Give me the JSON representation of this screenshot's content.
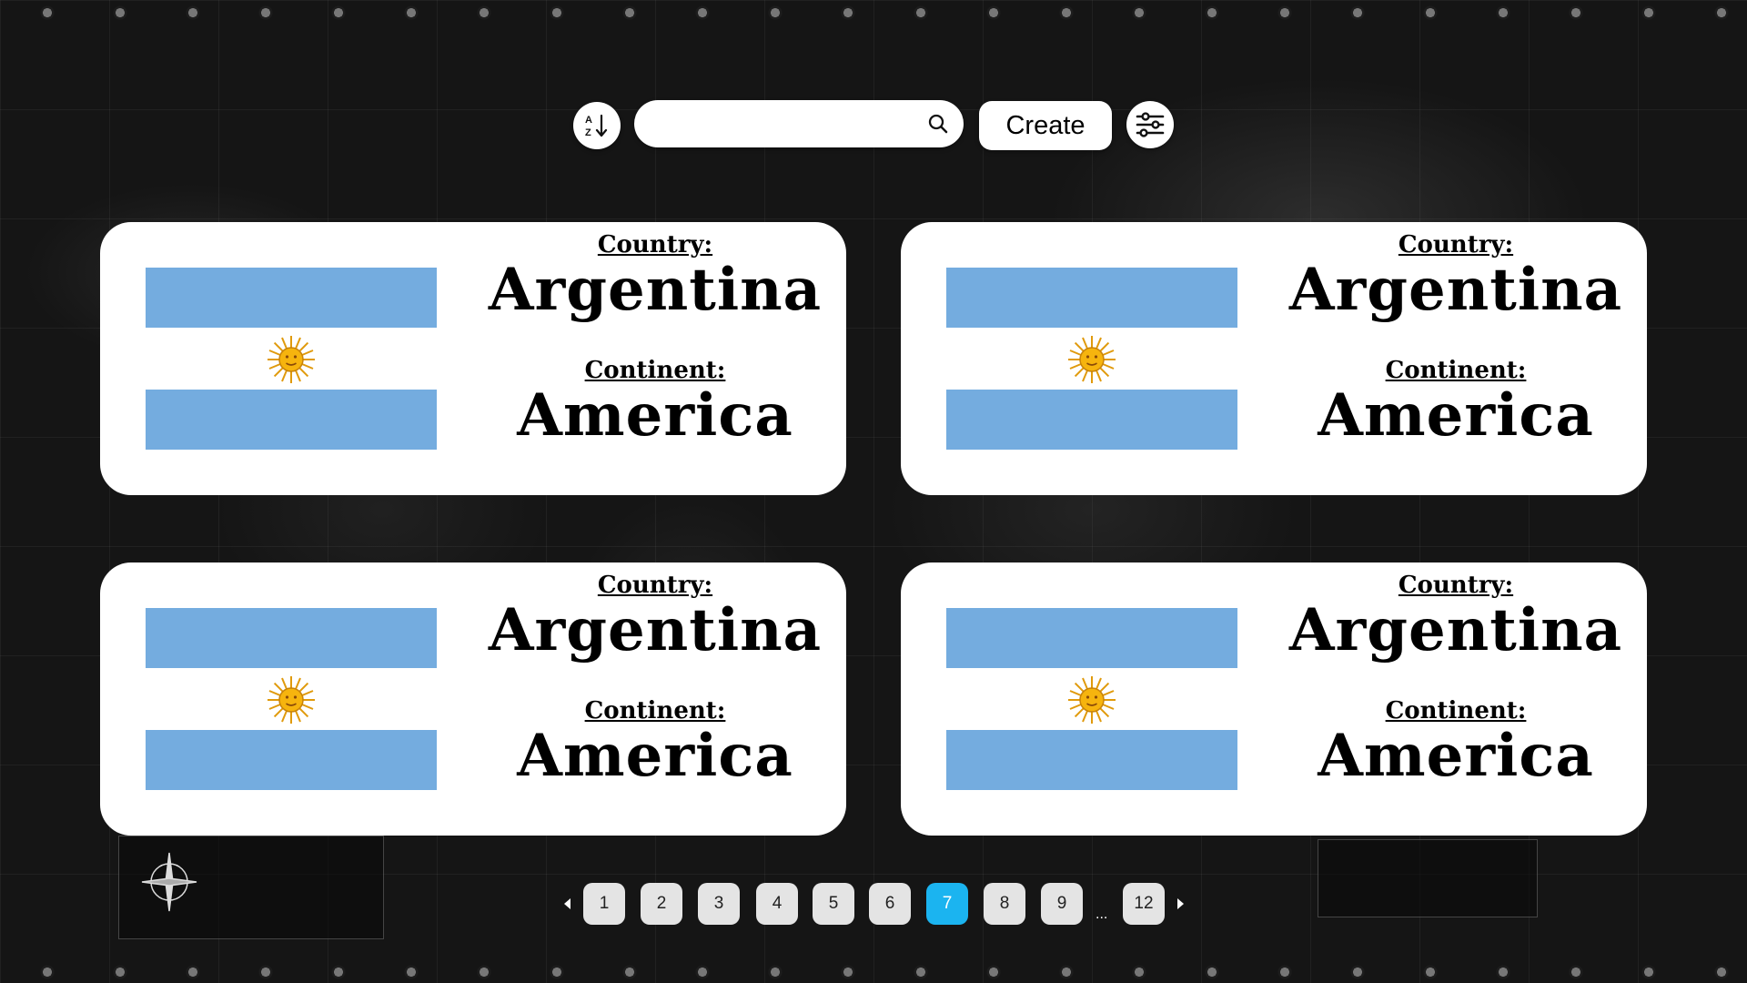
{
  "toolbar": {
    "sort_icon": "sort-alpha-icon",
    "search_value": "",
    "search_icon": "search-icon",
    "create_label": "Create",
    "filter_icon": "sliders-icon"
  },
  "cards": [
    {
      "country_label": "Country:",
      "country": "Argentina",
      "continent_label": "Continent:",
      "continent": "America",
      "flag": "flag-argentina-icon"
    },
    {
      "country_label": "Country:",
      "country": "Argentina",
      "continent_label": "Continent:",
      "continent": "America",
      "flag": "flag-argentina-icon"
    },
    {
      "country_label": "Country:",
      "country": "Argentina",
      "continent_label": "Continent:",
      "continent": "America",
      "flag": "flag-argentina-icon"
    },
    {
      "country_label": "Country:",
      "country": "Argentina",
      "continent_label": "Continent:",
      "continent": "America",
      "flag": "flag-argentina-icon"
    }
  ],
  "pagination": {
    "pages": [
      "1",
      "2",
      "3",
      "4",
      "5",
      "6",
      "7",
      "8",
      "9",
      "12"
    ],
    "current": "7",
    "ellipsis": "..."
  },
  "colors": {
    "flag_blue": "#74acdf",
    "sun": "#f6b40e",
    "active_page": "#1bb4f0"
  }
}
